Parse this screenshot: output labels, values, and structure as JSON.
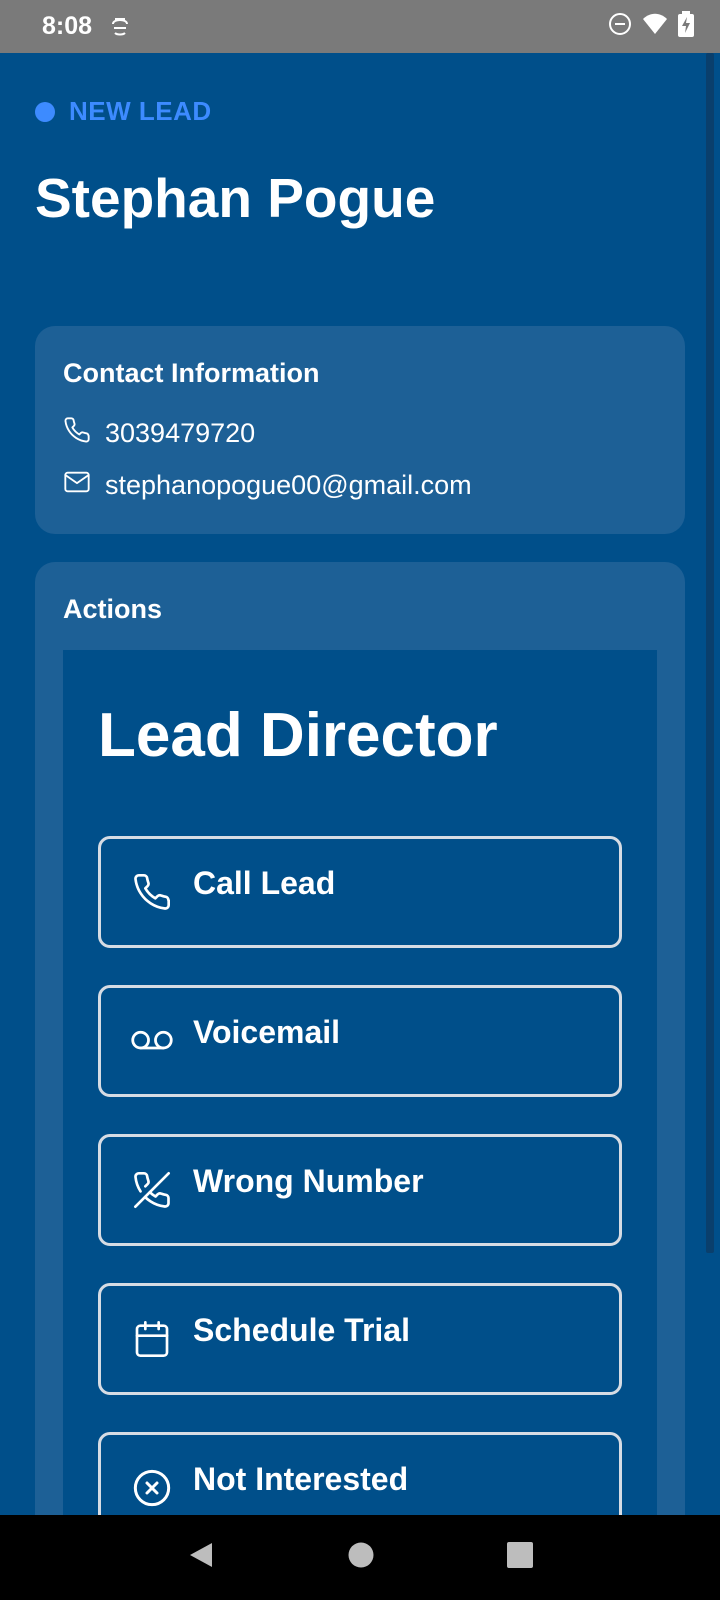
{
  "status_bar": {
    "time": "8:08",
    "app_icon": "app-notification-icon",
    "icons": [
      "do-not-disturb-icon",
      "wifi-icon",
      "battery-charging-icon"
    ]
  },
  "lead": {
    "status": "NEW LEAD",
    "name": "Stephan Pogue"
  },
  "contact": {
    "title": "Contact Information",
    "phone": "3039479720",
    "email": "stephanopogue00@gmail.com"
  },
  "actions": {
    "title": "Actions",
    "director_title": "Lead Director",
    "buttons": [
      {
        "label": "Call Lead",
        "icon": "phone-icon"
      },
      {
        "label": "Voicemail",
        "icon": "voicemail-icon"
      },
      {
        "label": "Wrong Number",
        "icon": "phone-off-icon"
      },
      {
        "label": "Schedule Trial",
        "icon": "calendar-icon"
      },
      {
        "label": "Not Interested",
        "icon": "x-circle-icon"
      }
    ]
  },
  "nav": {
    "icons": [
      "back-icon",
      "home-icon",
      "recents-icon"
    ]
  },
  "colors": {
    "background": "#004f8a",
    "card": "#1d6096",
    "accent": "#3d8bff",
    "status_bar": "#7a7a7a"
  }
}
